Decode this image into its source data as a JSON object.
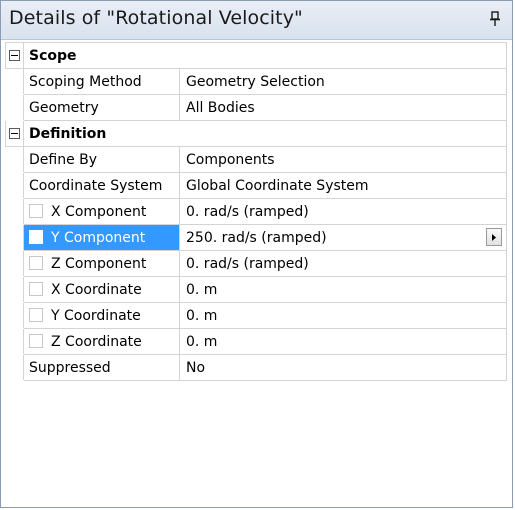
{
  "window": {
    "title": "Details of \"Rotational Velocity\"",
    "pin_icon": "pin-icon"
  },
  "groups": [
    {
      "name": "Scope",
      "expanded": true,
      "rows": [
        {
          "label": "Scoping Method",
          "value": "Geometry Selection",
          "checkbox": false
        },
        {
          "label": "Geometry",
          "value": "All Bodies",
          "checkbox": false
        }
      ]
    },
    {
      "name": "Definition",
      "expanded": true,
      "rows": [
        {
          "label": "Define By",
          "value": "Components",
          "checkbox": false
        },
        {
          "label": "Coordinate System",
          "value": "Global Coordinate System",
          "checkbox": false
        },
        {
          "label": "X Component",
          "value": "0. rad/s  (ramped)",
          "checkbox": true
        },
        {
          "label": "Y Component",
          "value": "250. rad/s  (ramped)",
          "checkbox": true,
          "selected": true,
          "has_dropdown": true
        },
        {
          "label": "Z Component",
          "value": "0. rad/s  (ramped)",
          "checkbox": true
        },
        {
          "label": "X Coordinate",
          "value": "0. m",
          "checkbox": true
        },
        {
          "label": "Y Coordinate",
          "value": "0. m",
          "checkbox": true
        },
        {
          "label": "Z Coordinate",
          "value": "0. m",
          "checkbox": true
        },
        {
          "label": "Suppressed",
          "value": "No",
          "checkbox": false
        }
      ]
    }
  ],
  "colors": {
    "selection": "#3399ff",
    "grid_line": "#d4d4d4",
    "title_bg": "#dfe6f1"
  }
}
